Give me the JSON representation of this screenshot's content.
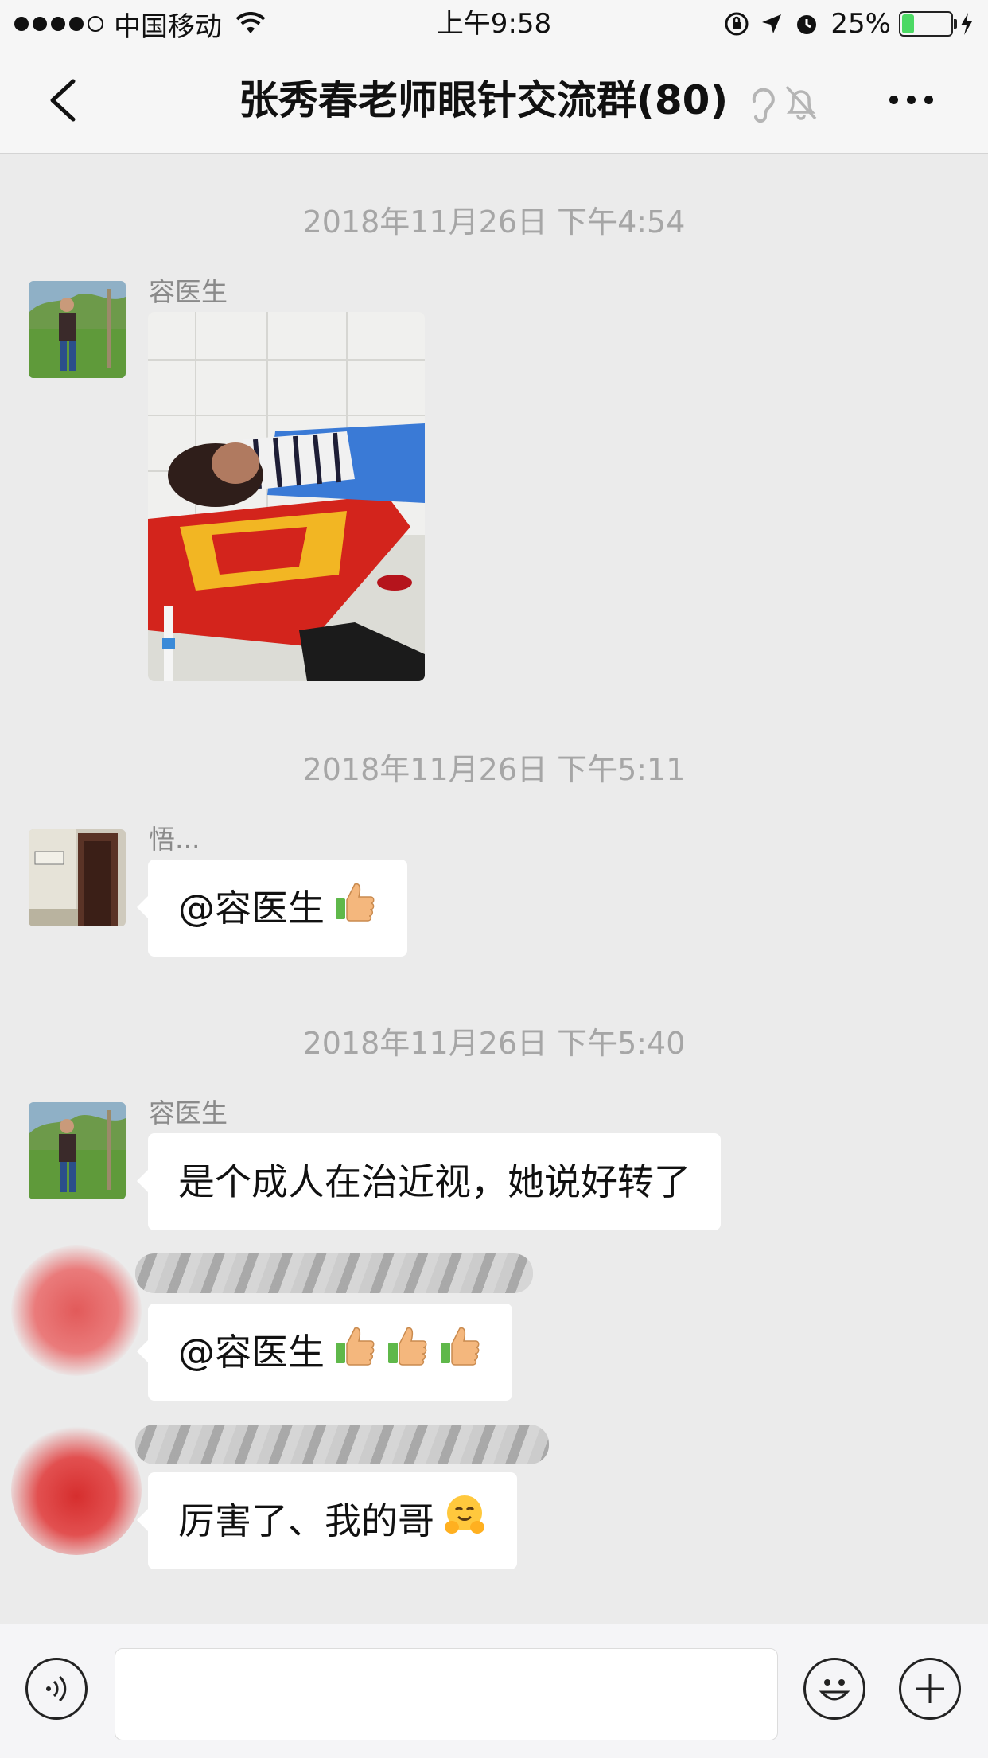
{
  "status_bar": {
    "carrier": "中国移动",
    "time": "上午9:58",
    "battery": "25%",
    "battery_level": 0.25
  },
  "nav": {
    "title": "张秀春老师眼针交流群(80)"
  },
  "messages": [
    {
      "timestamp": "2018年11月26日 下午4:54"
    },
    {
      "sender": "容医生",
      "type": "image"
    },
    {
      "timestamp": "2018年11月26日 下午5:11"
    },
    {
      "sender": "悟...",
      "text": "@容医生",
      "emoji": "thumbs-up"
    },
    {
      "timestamp": "2018年11月26日 下午5:40"
    },
    {
      "sender": "容医生",
      "text": "是个成人在治近视，她说好转了"
    },
    {
      "sender": "",
      "text": "@容医生",
      "emoji": "thumbs-up ×3"
    },
    {
      "sender": "",
      "text": "厉害了、我的哥",
      "emoji": "hugging-face"
    }
  ],
  "input_bar": {
    "voice_icon": "voice-icon",
    "emoji_icon": "smiley-icon",
    "plus_icon": "plus-icon"
  }
}
